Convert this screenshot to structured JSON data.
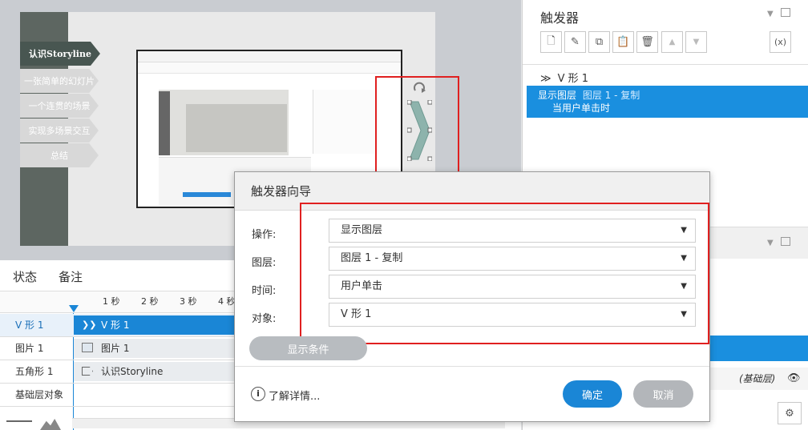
{
  "slide_menu": [
    "认识Storyline",
    "一张简单的幻灯片",
    "一个连贯的场景",
    "实现多场景交互",
    "总结"
  ],
  "triggers_panel": {
    "title": "触发器",
    "shape_name": "V 形 1",
    "trigger_action": "显示图层",
    "trigger_target": "图层 1 - 复制",
    "trigger_when": "当用户单击时",
    "layer_base": "(基础层)"
  },
  "timeline": {
    "tabs": [
      "状态",
      "备注"
    ],
    "ticks": [
      "1 秒",
      "2 秒",
      "3 秒",
      "4 秒"
    ],
    "rows": [
      {
        "label": "V 形 1",
        "bar": "V 形 1",
        "selected": true
      },
      {
        "label": "图片 1",
        "bar": "图片 1",
        "selected": false
      },
      {
        "label": "五角形 1",
        "bar": "认识Storyline",
        "selected": false
      },
      {
        "label": "基础层对象",
        "bar": "",
        "selected": false
      }
    ]
  },
  "dialog": {
    "title": "触发器向导",
    "fields": [
      {
        "label": "操作:",
        "value": "显示图层"
      },
      {
        "label": "图层:",
        "value": "图层 1 - 复制"
      },
      {
        "label": "时间:",
        "value": "用户单击"
      },
      {
        "label": "对象:",
        "value": "V 形 1"
      }
    ],
    "show_conditions": "显示条件",
    "learn_more": "了解详情...",
    "ok": "确定",
    "cancel": "取消"
  },
  "colors": {
    "accent": "#1a86d6",
    "highlight": "#1a8fdf",
    "red": "#e02020"
  }
}
